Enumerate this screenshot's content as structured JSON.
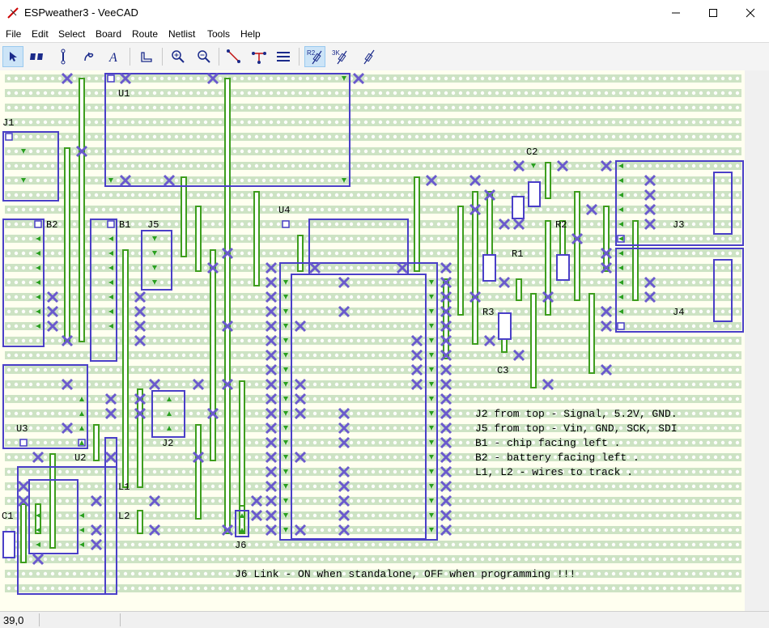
{
  "window": {
    "title": "ESPweather3 - VeeCAD",
    "minimize_icon": "minimize-icon",
    "maximize_icon": "maximize-icon",
    "close_icon": "close-icon"
  },
  "menu": [
    "File",
    "Edit",
    "Select",
    "Board",
    "Route",
    "Netlist",
    "Tools",
    "Help"
  ],
  "toolbar": {
    "tools": [
      {
        "name": "select-tool",
        "icon": "arrow-pointer-icon",
        "active": true
      },
      {
        "name": "component-tool",
        "icon": "component-icon"
      },
      {
        "name": "link-tool",
        "icon": "link-icon"
      },
      {
        "name": "wire-tool",
        "icon": "wire-icon"
      },
      {
        "name": "text-tool",
        "icon": "text-a-icon"
      },
      {
        "name": "ruler-tool",
        "icon": "ruler-icon"
      },
      {
        "name": "zoom-in-tool",
        "icon": "zoom-in-icon"
      },
      {
        "name": "zoom-out-tool",
        "icon": "zoom-out-icon"
      },
      {
        "name": "connectivity-tool",
        "icon": "connectivity-icon"
      },
      {
        "name": "net-trace-tool",
        "icon": "net-trace-icon"
      },
      {
        "name": "strips-tool",
        "icon": "strips-icon"
      },
      {
        "name": "r2-view-tool",
        "icon": "resistor-r2-icon",
        "label": "R2",
        "active": true
      },
      {
        "name": "3k-view-tool",
        "icon": "resistor-3k-icon",
        "label": "3K"
      },
      {
        "name": "blank-view-tool",
        "icon": "resistor-blank-icon"
      }
    ]
  },
  "board": {
    "labels": {
      "U1": "U1",
      "J1": "J1",
      "B2": "B2",
      "B1": "B1",
      "J5": "J5",
      "U4": "U4",
      "C2": "C2",
      "R2": "R2",
      "R1": "R1",
      "R3": "R3",
      "C3": "C3",
      "J3": "J3",
      "J4": "J4",
      "U3": "U3",
      "U2": "U2",
      "J2": "J2",
      "L1": "L1",
      "L2": "L2",
      "C1": "C1",
      "J6": "J6"
    },
    "notes": [
      "J2 from top - Signal, 5.2V, GND.",
      "J5 from top - Vin, GND, SCK, SDI",
      "B1 - chip facing left          .",
      "B2 - battery facing left       .",
      "L1, L2 - wires to track        ."
    ],
    "footer_note": "J6 Link - ON when standalone, OFF when programming !!!",
    "colors": {
      "strip": "#cde3c4",
      "hole": "#ffffff",
      "outline": "#4a3fc8",
      "link": "#3e9e1e",
      "cut": "#6a5acd",
      "pin": "#2aa020"
    }
  },
  "status": {
    "coord": "39,0"
  }
}
